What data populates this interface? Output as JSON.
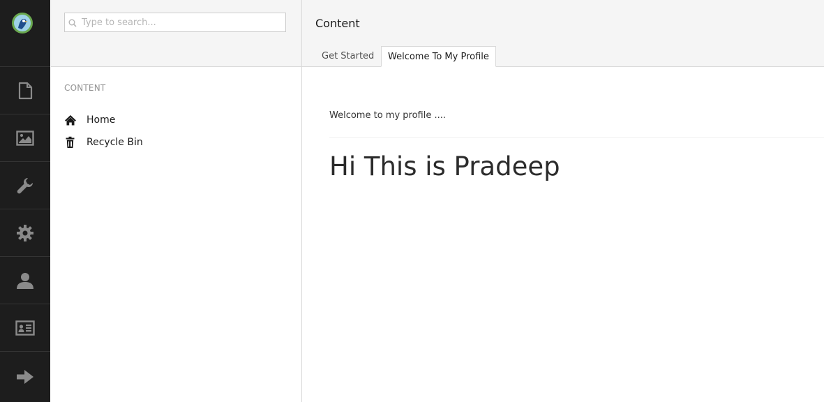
{
  "sections": [
    {
      "name": "content-section",
      "icon": "document-icon"
    },
    {
      "name": "media-section",
      "icon": "image-icon"
    },
    {
      "name": "developer-section",
      "icon": "wrench-icon"
    },
    {
      "name": "settings-section",
      "icon": "gear-icon"
    },
    {
      "name": "users-section",
      "icon": "user-icon"
    },
    {
      "name": "members-section",
      "icon": "id-card-icon"
    },
    {
      "name": "forms-section",
      "icon": "arrow-right-icon"
    }
  ],
  "search": {
    "placeholder": "Type to search..."
  },
  "tree": {
    "section_title": "CONTENT",
    "items": [
      {
        "label": "Home",
        "icon": "home-icon"
      },
      {
        "label": "Recycle Bin",
        "icon": "trash-icon"
      }
    ]
  },
  "editor": {
    "title": "Content",
    "tabs": [
      {
        "label": "Get Started",
        "active": false
      },
      {
        "label": "Welcome To My Profile",
        "active": true
      }
    ],
    "intro_text": "Welcome to my profile ....",
    "heading": "Hi This is Pradeep"
  },
  "colors": {
    "appbar_bg": "#1d1d1d",
    "icon_color": "#8a8a8a",
    "header_bg": "#f5f5f5"
  }
}
